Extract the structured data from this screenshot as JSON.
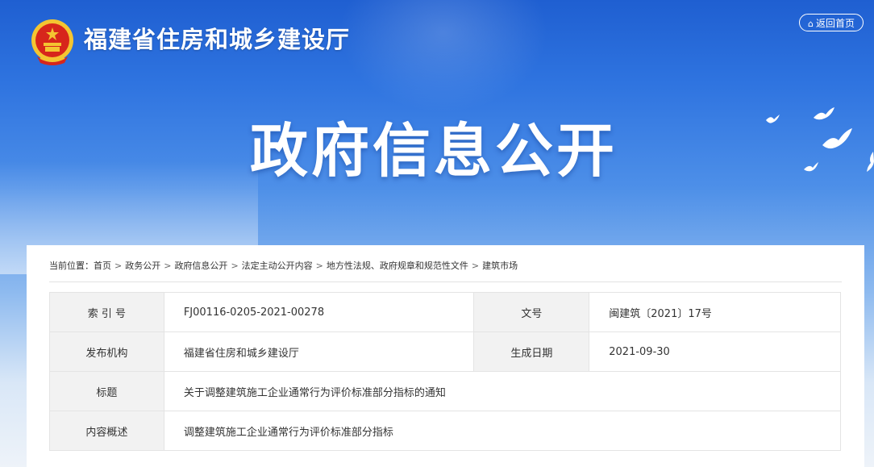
{
  "header": {
    "site_title": "福建省住房和城乡建设厅",
    "home_button": "返回首页",
    "banner_title": "政府信息公开"
  },
  "breadcrumb": {
    "prefix": "当前位置：",
    "items": [
      "首页",
      "政务公开",
      "政府信息公开",
      "法定主动公开内容",
      "地方性法规、政府规章和规范性文件",
      "建筑市场"
    ],
    "separator": ">"
  },
  "info_table": {
    "index_label": "索 引 号",
    "index_value": "FJ00116-0205-2021-00278",
    "doc_no_label": "文号",
    "doc_no_value": "闽建筑〔2021〕17号",
    "publisher_label": "发布机构",
    "publisher_value": "福建省住房和城乡建设厅",
    "date_label": "生成日期",
    "date_value": "2021-09-30",
    "title_label": "标题",
    "title_value": "关于调整建筑施工企业通常行为评价标准部分指标的通知",
    "summary_label": "内容概述",
    "summary_value": "调整建筑施工企业通常行为评价标准部分指标"
  },
  "colors": {
    "banner_top": "#1f5fd1",
    "banner_bottom": "#eef3f9",
    "label_bg": "#f2f2f2",
    "border": "#e4e4e4"
  },
  "icons": {
    "emblem": "national-emblem-icon",
    "home": "home-icon",
    "doves": "dove-icon"
  }
}
